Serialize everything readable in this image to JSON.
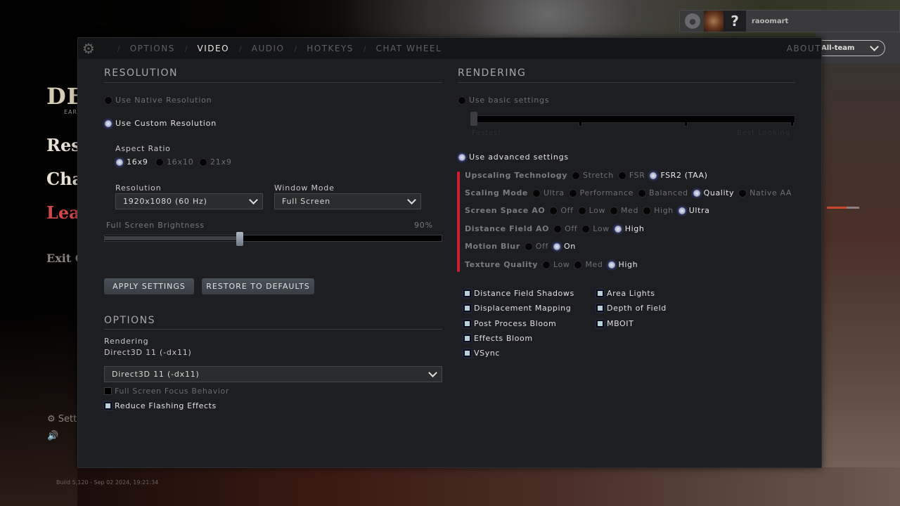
{
  "game_menu": {
    "logo": "DE",
    "logo_sub": "EARL",
    "items": [
      "Res",
      "Cha",
      "Leav",
      "Exit G"
    ],
    "settings_link": "Sett",
    "build": "Build 5,120 - Sep 02 2024, 19:21:34"
  },
  "social": {
    "help": "?",
    "username": "raoomart",
    "chat_scope": "All-team"
  },
  "tabs": [
    {
      "label": "OPTIONS",
      "active": false
    },
    {
      "label": "VIDEO",
      "active": true
    },
    {
      "label": "AUDIO",
      "active": false
    },
    {
      "label": "HOTKEYS",
      "active": false
    },
    {
      "label": "CHAT WHEEL",
      "active": false
    }
  ],
  "about": "ABOUT",
  "resolution": {
    "title": "RESOLUTION",
    "native": {
      "label": "Use Native Resolution",
      "selected": false
    },
    "custom": {
      "label": "Use Custom Resolution",
      "selected": true
    },
    "aspect_label": "Aspect Ratio",
    "aspect_options": [
      {
        "label": "16x9",
        "selected": true
      },
      {
        "label": "16x10",
        "selected": false
      },
      {
        "label": "21x9",
        "selected": false
      }
    ],
    "resolution_label": "Resolution",
    "resolution_value": "1920x1080 (60 Hz)",
    "window_mode_label": "Window Mode",
    "window_mode_value": "Full Screen",
    "brightness_label": "Full Screen Brightness",
    "brightness_value": "90%",
    "brightness_fraction": 0.9
  },
  "buttons": {
    "apply": "APPLY SETTINGS",
    "restore": "RESTORE TO DEFAULTS"
  },
  "options": {
    "title": "OPTIONS",
    "rendering_label": "Rendering",
    "rendering_current": "Direct3D 11 (-dx11)",
    "rendering_select": "Direct3D 11 (-dx11)",
    "full_screen_focus": {
      "label": "Full Screen Focus Behavior",
      "checked": false
    },
    "reduce_flashing": {
      "label": "Reduce Flashing Effects",
      "checked": true
    }
  },
  "rendering": {
    "title": "RENDERING",
    "basic": {
      "label": "Use basic settings",
      "selected": false,
      "min_label": "Fastest",
      "max_label": "Best Looking",
      "level": 0,
      "levels": 4
    },
    "advanced": {
      "label": "Use advanced settings",
      "selected": true
    },
    "rows": [
      {
        "label": "Upscaling Technology",
        "options": [
          "Stretch",
          "FSR",
          "FSR2 (TAA)"
        ],
        "selected": 2
      },
      {
        "label": "Scaling Mode",
        "options": [
          "Ultra",
          "Performance",
          "Balanced",
          "Quality",
          "Native AA"
        ],
        "selected": 3
      },
      {
        "label": "Screen Space AO",
        "options": [
          "Off",
          "Low",
          "Med",
          "High",
          "Ultra"
        ],
        "selected": 4
      },
      {
        "label": "Distance Field AO",
        "options": [
          "Off",
          "Low",
          "High"
        ],
        "selected": 2
      },
      {
        "label": "Motion Blur",
        "options": [
          "Off",
          "On"
        ],
        "selected": 1
      },
      {
        "label": "Texture Quality",
        "options": [
          "Low",
          "Med",
          "High"
        ],
        "selected": 2
      }
    ],
    "checkboxes_left": [
      {
        "label": "Distance Field Shadows",
        "checked": true
      },
      {
        "label": "Displacement Mapping",
        "checked": true
      },
      {
        "label": "Post Process Bloom",
        "checked": true
      },
      {
        "label": "Effects Bloom",
        "checked": true
      },
      {
        "label": "VSync",
        "checked": true
      }
    ],
    "checkboxes_right": [
      {
        "label": "Area Lights",
        "checked": true
      },
      {
        "label": "Depth of Field",
        "checked": true
      },
      {
        "label": "MBOIT",
        "checked": true
      }
    ]
  }
}
